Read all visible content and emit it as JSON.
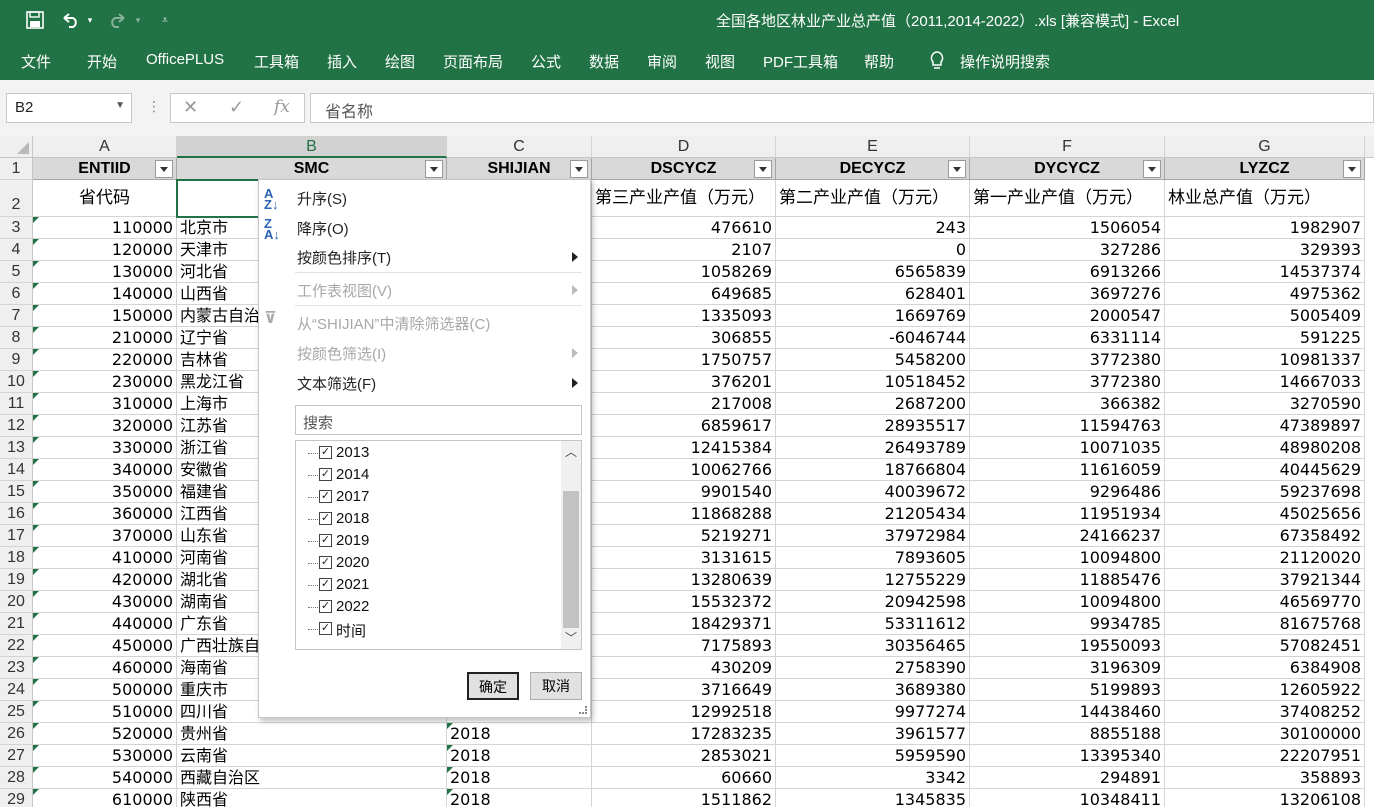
{
  "titlebar": {
    "title": "全国各地区林业产业总产值（2011,2014-2022）.xls [兼容模式] - Excel",
    "save_icon": "save-icon",
    "undo_icon": "undo-icon",
    "redo_icon": "redo-icon",
    "customize_icon": "customize-quick-access-icon"
  },
  "ribbon": {
    "tabs": [
      "文件",
      "开始",
      "OfficePLUS",
      "工具箱",
      "插入",
      "绘图",
      "页面布局",
      "公式",
      "数据",
      "审阅",
      "视图",
      "PDF工具箱",
      "帮助"
    ],
    "tell_me": "操作说明搜索"
  },
  "formula_bar": {
    "name_box": "B2",
    "formula": "省名称"
  },
  "columns": [
    "A",
    "B",
    "C",
    "D",
    "E",
    "F",
    "G"
  ],
  "header_row": [
    "ENTIID",
    "SMC",
    "SHIJIAN",
    "DSCYCZ",
    "DECYCZ",
    "DYCYCZ",
    "LYZCZ"
  ],
  "label_row": [
    "省代码",
    "",
    "",
    "第三产业产值（万元）",
    "第二产业产值（万元）",
    "第一产业产值（万元）",
    "林业总产值（万元）"
  ],
  "rows": [
    {
      "n": "3",
      "a": "110000",
      "b": "北京市",
      "c": "",
      "d": "476610",
      "e": "243",
      "f": "1506054",
      "g": "1982907"
    },
    {
      "n": "4",
      "a": "120000",
      "b": "天津市",
      "c": "",
      "d": "2107",
      "e": "0",
      "f": "327286",
      "g": "329393"
    },
    {
      "n": "5",
      "a": "130000",
      "b": "河北省",
      "c": "",
      "d": "1058269",
      "e": "6565839",
      "f": "6913266",
      "g": "14537374"
    },
    {
      "n": "6",
      "a": "140000",
      "b": "山西省",
      "c": "",
      "d": "649685",
      "e": "628401",
      "f": "3697276",
      "g": "4975362"
    },
    {
      "n": "7",
      "a": "150000",
      "b": "内蒙古自治",
      "c": "",
      "d": "1335093",
      "e": "1669769",
      "f": "2000547",
      "g": "5005409"
    },
    {
      "n": "8",
      "a": "210000",
      "b": "辽宁省",
      "c": "",
      "d": "306855",
      "e": "-6046744",
      "f": "6331114",
      "g": "591225"
    },
    {
      "n": "9",
      "a": "220000",
      "b": "吉林省",
      "c": "",
      "d": "1750757",
      "e": "5458200",
      "f": "3772380",
      "g": "10981337"
    },
    {
      "n": "10",
      "a": "230000",
      "b": "黑龙江省",
      "c": "",
      "d": "376201",
      "e": "10518452",
      "f": "3772380",
      "g": "14667033"
    },
    {
      "n": "11",
      "a": "310000",
      "b": "上海市",
      "c": "",
      "d": "217008",
      "e": "2687200",
      "f": "366382",
      "g": "3270590"
    },
    {
      "n": "12",
      "a": "320000",
      "b": "江苏省",
      "c": "",
      "d": "6859617",
      "e": "28935517",
      "f": "11594763",
      "g": "47389897"
    },
    {
      "n": "13",
      "a": "330000",
      "b": "浙江省",
      "c": "",
      "d": "12415384",
      "e": "26493789",
      "f": "10071035",
      "g": "48980208"
    },
    {
      "n": "14",
      "a": "340000",
      "b": "安徽省",
      "c": "",
      "d": "10062766",
      "e": "18766804",
      "f": "11616059",
      "g": "40445629"
    },
    {
      "n": "15",
      "a": "350000",
      "b": "福建省",
      "c": "",
      "d": "9901540",
      "e": "40039672",
      "f": "9296486",
      "g": "59237698"
    },
    {
      "n": "16",
      "a": "360000",
      "b": "江西省",
      "c": "",
      "d": "11868288",
      "e": "21205434",
      "f": "11951934",
      "g": "45025656"
    },
    {
      "n": "17",
      "a": "370000",
      "b": "山东省",
      "c": "",
      "d": "5219271",
      "e": "37972984",
      "f": "24166237",
      "g": "67358492"
    },
    {
      "n": "18",
      "a": "410000",
      "b": "河南省",
      "c": "",
      "d": "3131615",
      "e": "7893605",
      "f": "10094800",
      "g": "21120020"
    },
    {
      "n": "19",
      "a": "420000",
      "b": "湖北省",
      "c": "",
      "d": "13280639",
      "e": "12755229",
      "f": "11885476",
      "g": "37921344"
    },
    {
      "n": "20",
      "a": "430000",
      "b": "湖南省",
      "c": "",
      "d": "15532372",
      "e": "20942598",
      "f": "10094800",
      "g": "46569770"
    },
    {
      "n": "21",
      "a": "440000",
      "b": "广东省",
      "c": "",
      "d": "18429371",
      "e": "53311612",
      "f": "9934785",
      "g": "81675768"
    },
    {
      "n": "22",
      "a": "450000",
      "b": "广西壮族自",
      "c": "",
      "d": "7175893",
      "e": "30356465",
      "f": "19550093",
      "g": "57082451"
    },
    {
      "n": "23",
      "a": "460000",
      "b": "海南省",
      "c": "",
      "d": "430209",
      "e": "2758390",
      "f": "3196309",
      "g": "6384908"
    },
    {
      "n": "24",
      "a": "500000",
      "b": "重庆市",
      "c": "",
      "d": "3716649",
      "e": "3689380",
      "f": "5199893",
      "g": "12605922"
    },
    {
      "n": "25",
      "a": "510000",
      "b": "四川省",
      "c": "",
      "d": "12992518",
      "e": "9977274",
      "f": "14438460",
      "g": "37408252"
    },
    {
      "n": "26",
      "a": "520000",
      "b": "贵州省",
      "c": "2018",
      "d": "17283235",
      "e": "3961577",
      "f": "8855188",
      "g": "30100000"
    },
    {
      "n": "27",
      "a": "530000",
      "b": "云南省",
      "c": "2018",
      "d": "2853021",
      "e": "5959590",
      "f": "13395340",
      "g": "22207951"
    },
    {
      "n": "28",
      "a": "540000",
      "b": "西藏自治区",
      "c": "2018",
      "d": "60660",
      "e": "3342",
      "f": "294891",
      "g": "358893"
    },
    {
      "n": "29",
      "a": "610000",
      "b": "陕西省",
      "c": "2018",
      "d": "1511862",
      "e": "1345835",
      "f": "10348411",
      "g": "13206108"
    }
  ],
  "filter_menu": {
    "sort_asc": "升序(S)",
    "sort_desc": "降序(O)",
    "sort_by_color": "按颜色排序(T)",
    "sheet_view": "工作表视图(V)",
    "clear_filter": "从“SHIJIAN”中清除筛选器(C)",
    "filter_by_color": "按颜色筛选(I)",
    "text_filter": "文本筛选(F)",
    "search_placeholder": "搜索",
    "items": [
      {
        "label": "2013",
        "checked": true
      },
      {
        "label": "2014",
        "checked": true
      },
      {
        "label": "2017",
        "checked": true
      },
      {
        "label": "2018",
        "checked": true
      },
      {
        "label": "2019",
        "checked": true
      },
      {
        "label": "2020",
        "checked": true
      },
      {
        "label": "2021",
        "checked": true
      },
      {
        "label": "2022",
        "checked": true
      },
      {
        "label": "时间",
        "checked": true
      }
    ],
    "ok": "确定",
    "cancel": "取消"
  }
}
